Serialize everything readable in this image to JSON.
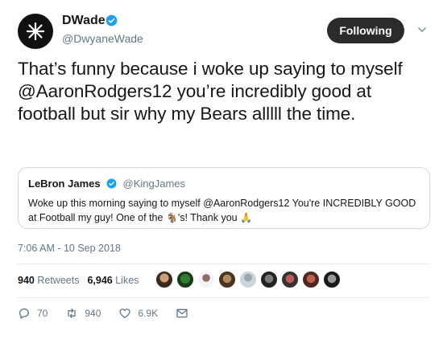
{
  "header": {
    "display_name": "DWade",
    "handle": "@DwyaneWade",
    "follow_label": "Following"
  },
  "tweet": {
    "text": "That’s funny because i woke up saying to myself @AaronRodgers12 you’re incredibly good at football but sir why my Bears alllll the time."
  },
  "quote": {
    "name": "LeBron James",
    "handle": "@KingJames",
    "text_part1": "Woke up this morning saying to myself @AaronRodgers12 You're INCREDIBLY GOOD at Football my guy! One of the ",
    "text_part2": "'s! Thank you "
  },
  "timestamp": "7:06 AM - 10 Sep 2018",
  "stats": {
    "retweets_count": "940",
    "retweets_label": "Retweets",
    "likes_count": "6,946",
    "likes_label": "Likes"
  },
  "actions": {
    "reply_count": "70",
    "retweet_count": "940",
    "like_count": "6.9K"
  },
  "colors": {
    "verified": "#1da1f2",
    "follow_button": "#2b2b2b",
    "secondary_text": "#657786"
  }
}
